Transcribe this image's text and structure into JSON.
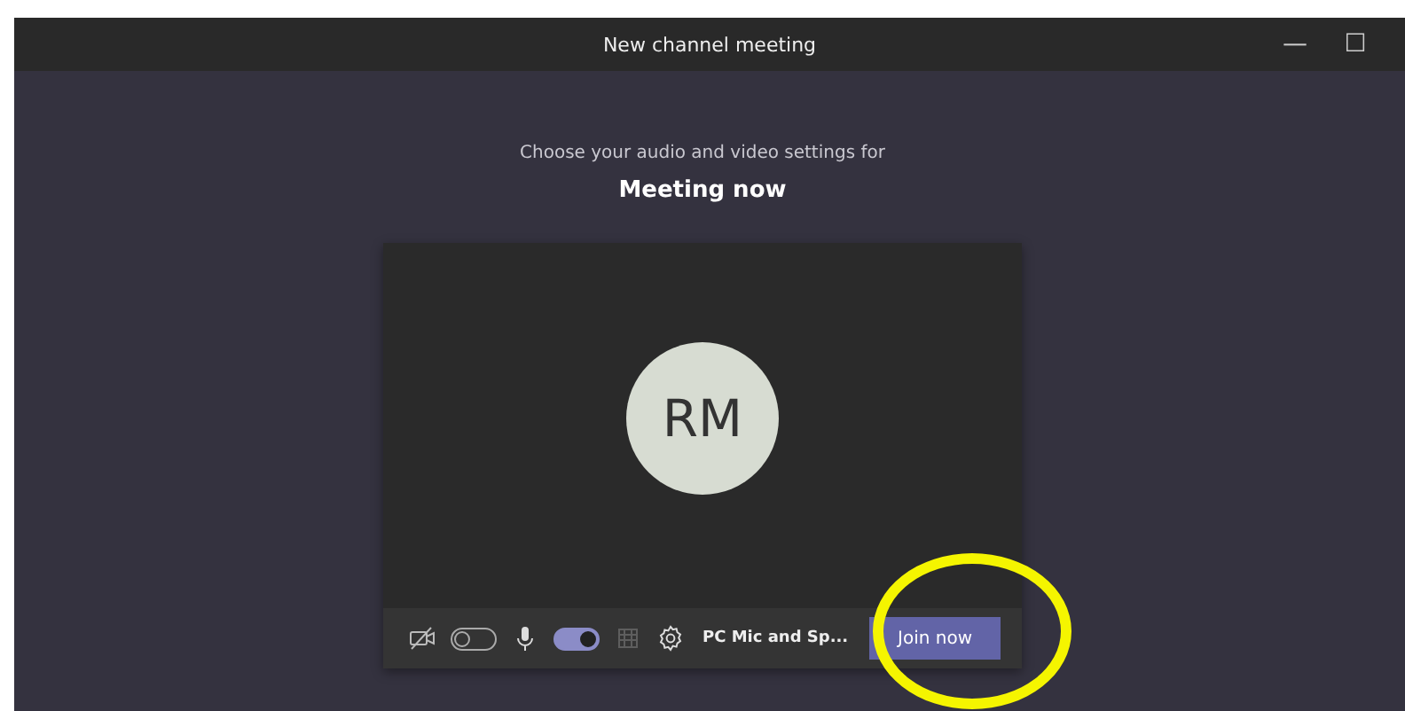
{
  "window": {
    "title": "New channel meeting",
    "controls": [
      "—",
      "☐"
    ]
  },
  "prompt": "Choose your audio and video settings for",
  "meeting_title": "Meeting now",
  "preview": {
    "avatar_initials": "RM"
  },
  "controls": {
    "camera_on": false,
    "mic_on": true,
    "blur_disabled": true,
    "audio_device": "PC Mic and Sp...",
    "join_label": "Join now"
  },
  "highlight": {
    "kind": "circle"
  }
}
